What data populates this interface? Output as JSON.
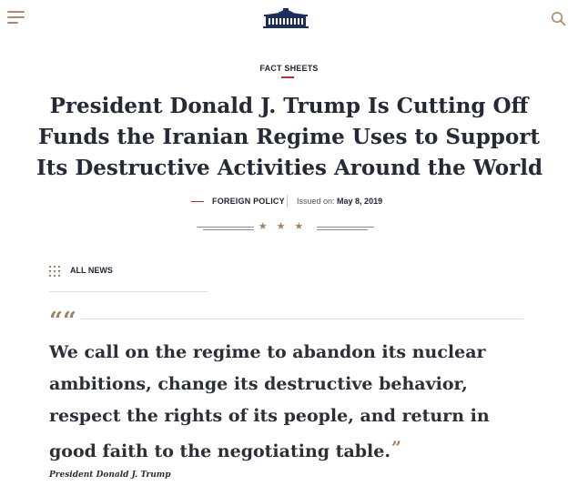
{
  "header": {
    "menu_icon": "hamburger-menu-icon",
    "logo_icon": "white-house-logo",
    "search_icon": "search-icon"
  },
  "article": {
    "category": "FACT SHEETS",
    "title_lines": [
      "President Donald J. Trump Is Cutting Off",
      "Funds the Iranian Regime Uses to Support",
      "Its Destructive Activities Around the World"
    ],
    "issue": "FOREIGN POLICY",
    "issued_label": "Issued on:",
    "issued_date": "May 8, 2019"
  },
  "nav": {
    "all_news_label": "ALL NEWS",
    "all_news_icon": "grid-dots-icon"
  },
  "quote": {
    "open_mark": "““",
    "lines": [
      "We call on the regime to abandon its nuclear",
      "ambitions, change its destructive behavior,",
      "respect the rights of its people, and return in",
      "good faith to the negotiating table."
    ],
    "close_mark": "”",
    "attribution": "President Donald J. Trump"
  },
  "colors": {
    "accent_red": "#b0323f",
    "accent_gold": "#a08266",
    "text_dark": "#262a37"
  }
}
